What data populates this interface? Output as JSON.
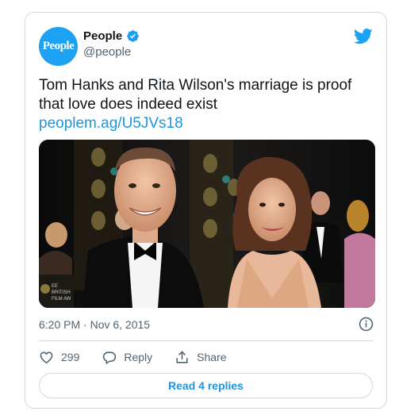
{
  "author": {
    "avatar_text": "People",
    "display_name": "People",
    "handle": "@people",
    "verified": true
  },
  "tweet": {
    "text": "Tom Hanks and Rita Wilson's marriage is proof that love does indeed exist",
    "link": "peoplem.ag/U5JVs18",
    "photo_caption_text": "EE BRITISH FILM AW",
    "timestamp": "6:20 PM · Nov 6, 2015"
  },
  "actions": {
    "like_count": "299",
    "reply_label": "Reply",
    "share_label": "Share"
  },
  "read_replies_label": "Read 4 replies",
  "colors": {
    "brand_blue": "#1da1f2",
    "link_blue": "#1b95e0",
    "muted_text": "#536471",
    "border": "#cfd9de"
  }
}
